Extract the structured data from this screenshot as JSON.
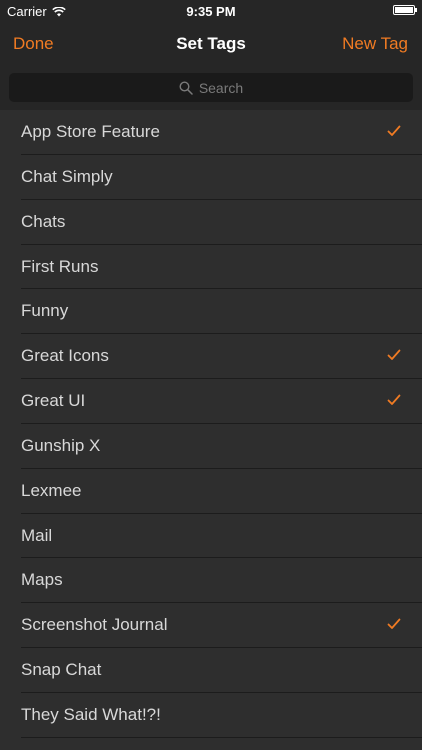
{
  "status_bar": {
    "carrier": "Carrier",
    "time": "9:35 PM"
  },
  "nav": {
    "left_button": "Done",
    "title": "Set Tags",
    "right_button": "New Tag"
  },
  "search": {
    "placeholder": "Search"
  },
  "colors": {
    "accent": "#f07b23",
    "background": "#2e2e2e",
    "bar_background": "#262626"
  },
  "tags": [
    {
      "label": "App Store Feature",
      "checked": true
    },
    {
      "label": "Chat Simply",
      "checked": false
    },
    {
      "label": "Chats",
      "checked": false
    },
    {
      "label": "First Runs",
      "checked": false
    },
    {
      "label": "Funny",
      "checked": false
    },
    {
      "label": "Great Icons",
      "checked": true
    },
    {
      "label": "Great UI",
      "checked": true
    },
    {
      "label": "Gunship X",
      "checked": false
    },
    {
      "label": "Lexmee",
      "checked": false
    },
    {
      "label": "Mail",
      "checked": false
    },
    {
      "label": "Maps",
      "checked": false
    },
    {
      "label": "Screenshot Journal",
      "checked": true
    },
    {
      "label": "Snap Chat",
      "checked": false
    },
    {
      "label": "They Said What!?!",
      "checked": false
    }
  ]
}
